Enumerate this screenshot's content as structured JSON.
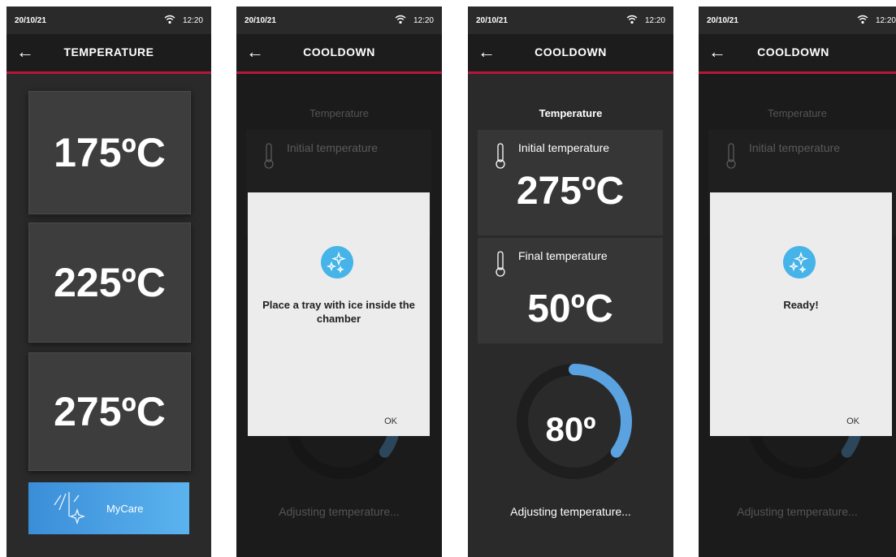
{
  "status_bar": {
    "date": "20/10/21",
    "time": "12:20"
  },
  "screen1": {
    "title": "TEMPERATURE",
    "options": [
      "175ºC",
      "225ºC",
      "275ºC"
    ],
    "mycare_label": "MyCare"
  },
  "screen2": {
    "title": "COOLDOWN",
    "section_label": "Temperature",
    "initial_label": "Initial temperature",
    "modal_text": "Place a tray with ice inside the chamber",
    "ok_label": "OK",
    "status_text": "Adjusting temperature..."
  },
  "screen3": {
    "title": "COOLDOWN",
    "section_label": "Temperature",
    "initial_label": "Initial temperature",
    "initial_value": "275ºC",
    "final_label": "Final temperature",
    "final_value": "50ºC",
    "gauge_value": "80º",
    "gauge_progress": 0.35,
    "status_text": "Adjusting temperature..."
  },
  "screen4": {
    "title": "COOLDOWN",
    "section_label": "Temperature",
    "initial_label": "Initial temperature",
    "modal_text": "Ready!",
    "ok_label": "OK",
    "status_text": "Adjusting temperature..."
  },
  "colors": {
    "accent_red": "#b5163c",
    "accent_blue": "#46b4e8",
    "gauge_blue": "#5aa2e0"
  },
  "icons": [
    "back-arrow-icon",
    "wifi-icon",
    "thermometer-icon",
    "sparkle-icon"
  ]
}
